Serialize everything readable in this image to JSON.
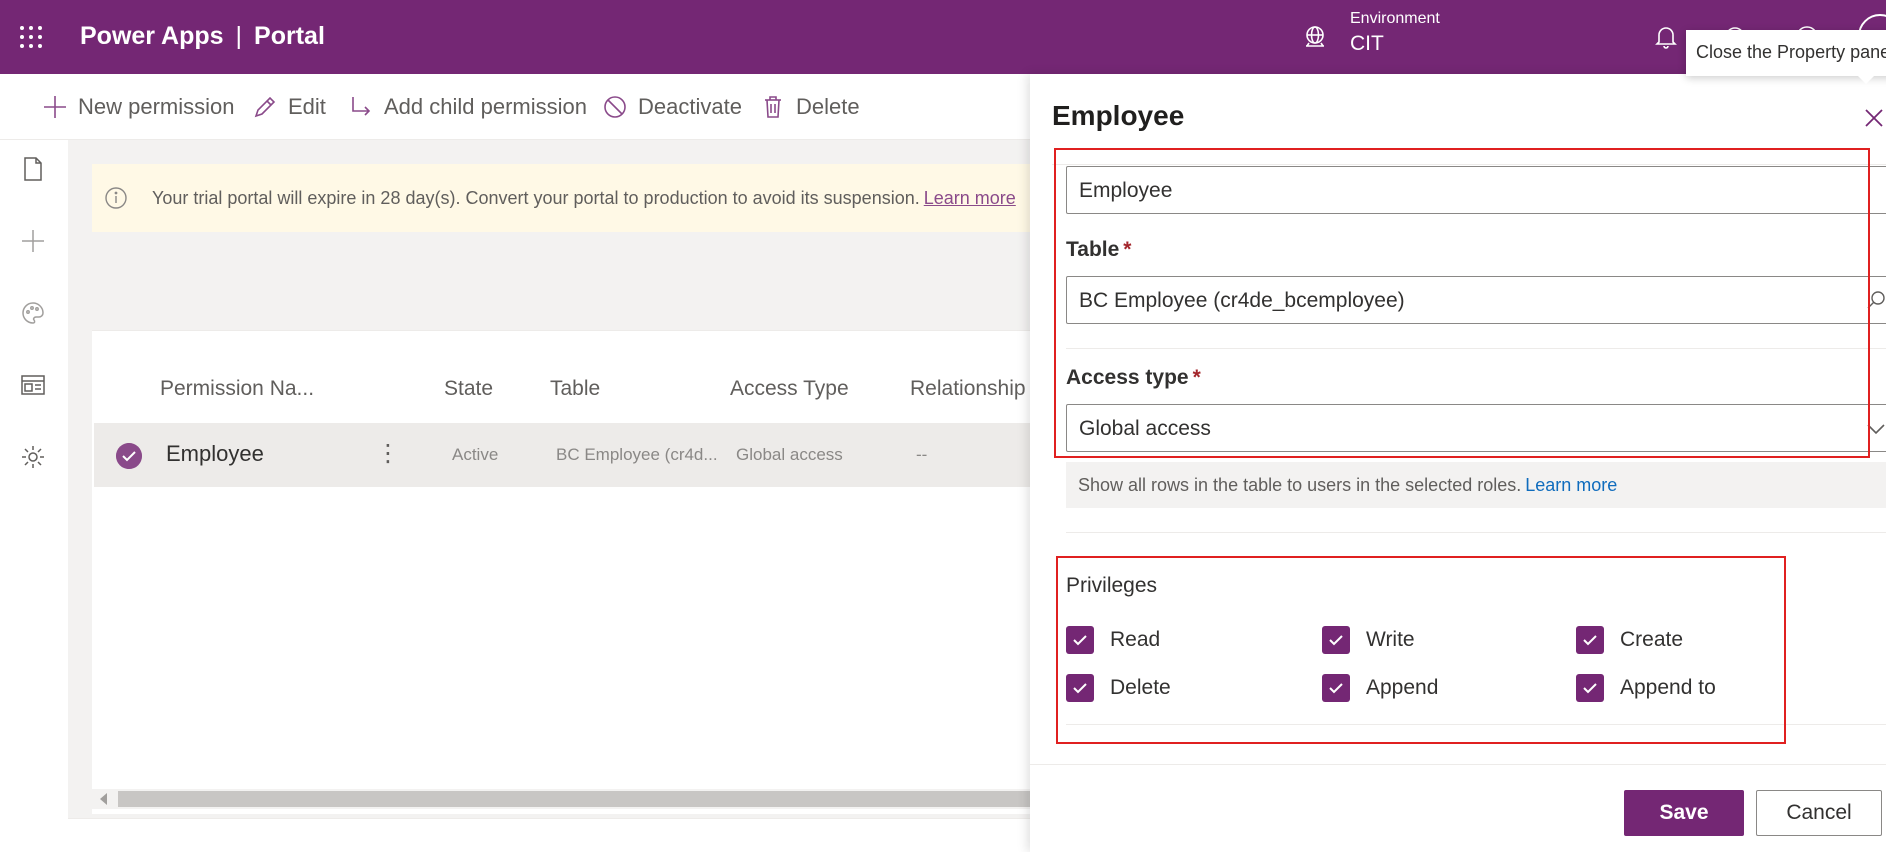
{
  "app": {
    "product": "Power Apps",
    "separator": "|",
    "section": "Portal",
    "environment_label": "Environment",
    "environment_value": "CIT",
    "tooltip": "Close the Property pane"
  },
  "commands": {
    "new_permission": "New permission",
    "edit": "Edit",
    "add_child_permission": "Add child permission",
    "deactivate": "Deactivate",
    "delete": "Delete"
  },
  "banner": {
    "message": "Your trial portal will expire in 28 day(s). Convert your portal to production to avoid its suspension.",
    "link": "Learn more"
  },
  "grid": {
    "columns": [
      "Permission Na...",
      "State",
      "Table",
      "Access Type",
      "Relationship"
    ],
    "rows": [
      {
        "name": "Employee",
        "state": "Active",
        "table": "BC Employee (cr4d...",
        "access_type": "Global access",
        "relationship": "--"
      }
    ]
  },
  "panel": {
    "title": "Employee",
    "name_value": "Employee",
    "table_label": "Table",
    "table_value": "BC Employee (cr4de_bcemployee)",
    "access_label": "Access type",
    "access_value": "Global access",
    "required_mark": "*",
    "hint": "Show all rows in the table to users in the selected roles.",
    "hint_link": "Learn more",
    "privileges_title": "Privileges",
    "privileges": [
      {
        "label": "Read",
        "checked": true
      },
      {
        "label": "Write",
        "checked": true
      },
      {
        "label": "Create",
        "checked": true
      },
      {
        "label": "Delete",
        "checked": true
      },
      {
        "label": "Append",
        "checked": true
      },
      {
        "label": "Append to",
        "checked": true
      }
    ],
    "save": "Save",
    "cancel": "Cancel"
  },
  "colors": {
    "brand": "#742774",
    "highlight": "#e02020"
  }
}
